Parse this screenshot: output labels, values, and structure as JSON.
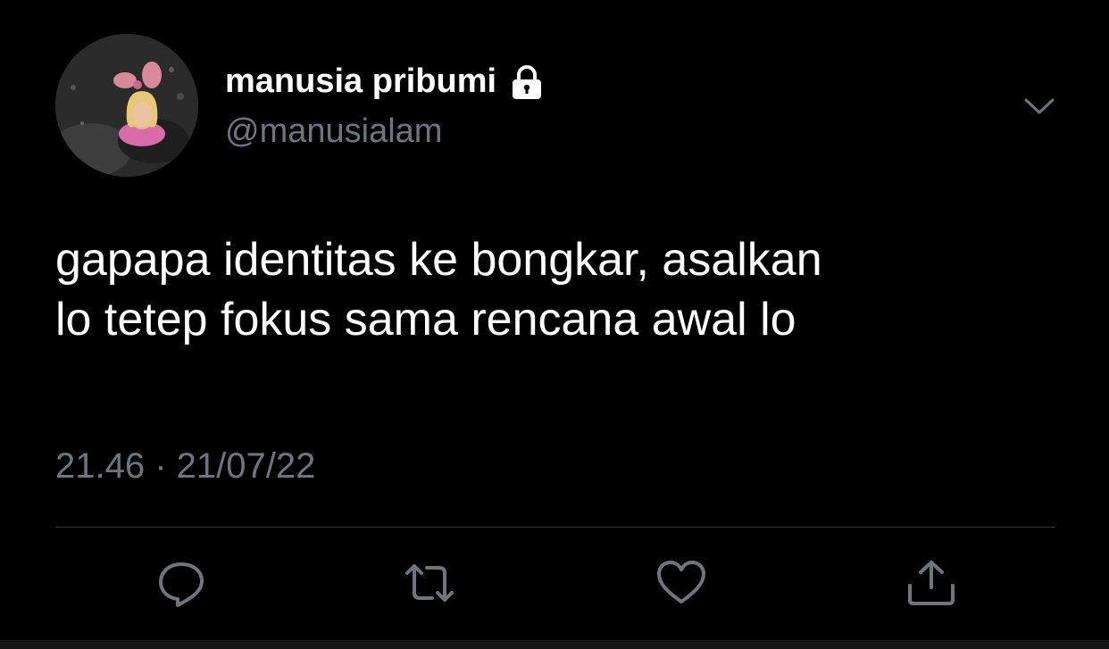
{
  "user": {
    "display_name": "manusia pribumi",
    "handle": "@manusialam",
    "avatar_icon": "avatar-doll-photo",
    "protected_icon": "lock-icon"
  },
  "tweet": {
    "lines": [
      "gapapa identitas ke bongkar, asalkan",
      "lo tetep fokus sama rencana awal lo"
    ],
    "timestamp": "21.46 · 21/07/22"
  },
  "actions": [
    "reply-icon",
    "retweet-icon",
    "like-icon",
    "share-icon"
  ],
  "colors": {
    "background": "#000000",
    "text": "#ffffff",
    "secondary_text": "#6e767d",
    "divider": "#2f3336"
  }
}
